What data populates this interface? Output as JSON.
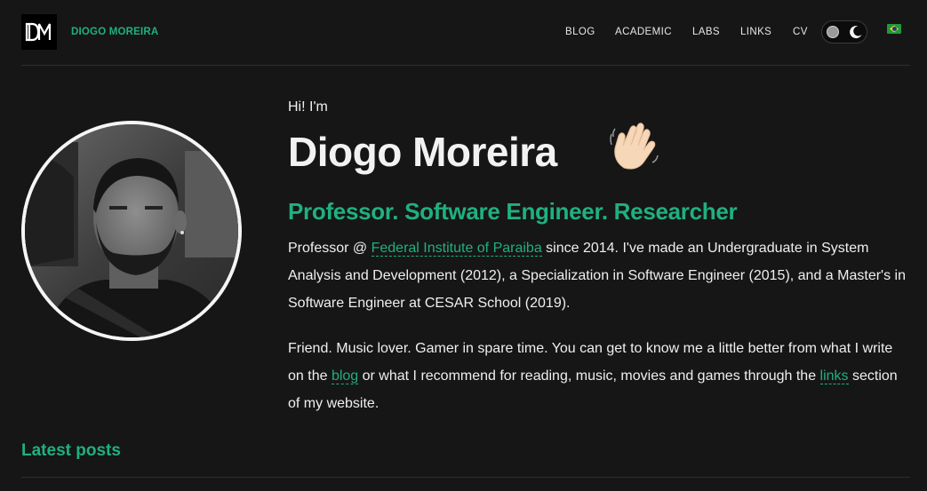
{
  "header": {
    "site_name": "DIOGO MOREIRA",
    "nav": [
      "BLOG",
      "ACADEMIC",
      "LABS",
      "LINKS",
      "CV"
    ]
  },
  "hero": {
    "greeting": "Hi! I'm",
    "name": "Diogo Moreira",
    "subtitle": "Professor. Software Engineer. Researcher",
    "para1_prefix": "Professor @ ",
    "para1_link": "Federal Institute of Paraiba",
    "para1_rest": " since 2014. I've made an Undergraduate in System Analysis and Development (2012), a Specialization in Software Engineer (2015), and a Master's in Software Engineer at CESAR School (2019).",
    "para2_prefix": "Friend. Music lover. Gamer in spare time. You can get to know me a little better from what I write on the ",
    "para2_link_blog": "blog",
    "para2_middle": " or what I recommend for reading, music, movies and games through the ",
    "para2_link_links": "links",
    "para2_suffix": " section of my website."
  },
  "latest_posts": "Latest posts",
  "colors": {
    "accent": "#20b07f",
    "background": "#161616",
    "text": "#f2f2f2"
  },
  "icons": [
    "dm-logo",
    "theme-toggle",
    "moon-icon",
    "brazil-flag-icon",
    "waving-hand-icon"
  ]
}
